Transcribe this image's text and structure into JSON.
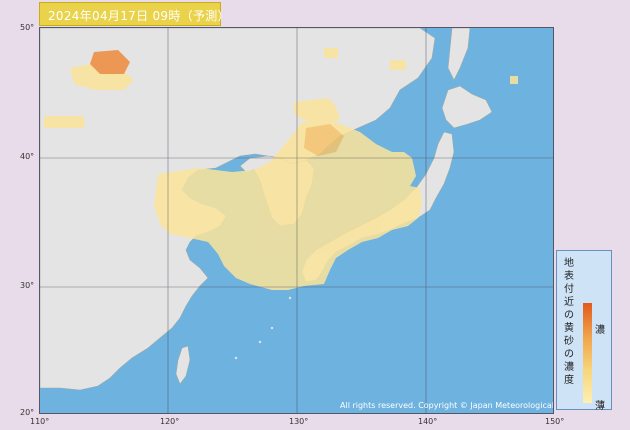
{
  "header": {
    "title": "2024年04月17日 09時（予測）"
  },
  "map": {
    "lat_labels": [
      "50°",
      "40°",
      "30°",
      "20°"
    ],
    "lon_labels": [
      "110°",
      "120°",
      "130°",
      "140°",
      "150°"
    ],
    "copyright": "All rights reserved. Copyright © Japan Meteorological Agency"
  },
  "legend": {
    "title_chars": [
      "地",
      "表",
      "付",
      "近",
      "の",
      "黄",
      "砂",
      "の",
      "濃",
      "度"
    ],
    "high_label": "濃",
    "low_label": "薄"
  },
  "colors": {
    "sea": "#6eb2df",
    "land": "#e6e6e6",
    "dust_light": "#fdf0b4",
    "dust_mid": "#f7d57a",
    "dust_high": "#f0a24b",
    "dust_max": "#e05a1e"
  }
}
